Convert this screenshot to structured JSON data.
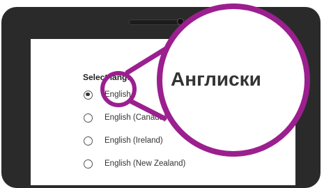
{
  "screen": {
    "title": "Select language",
    "options": [
      {
        "label": "English (Australia)",
        "selected": true
      },
      {
        "label": "English (Canada)",
        "selected": false
      },
      {
        "label": "English (Ireland)",
        "selected": false
      },
      {
        "label": "English (New Zealand)",
        "selected": false
      }
    ]
  },
  "magnifier": {
    "text": "Англиски",
    "ring_color": "#9b1f8e"
  }
}
